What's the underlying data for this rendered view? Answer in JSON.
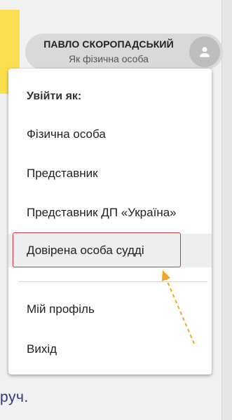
{
  "user": {
    "name": "ПАВЛО СКОРОПАДСЬКИЙ",
    "role": "Як фізична особа"
  },
  "menu": {
    "header": "Увійти як:",
    "items": [
      {
        "label": "Фізична особа"
      },
      {
        "label": "Представник"
      },
      {
        "label": "Представник ДП «Україна»"
      },
      {
        "label": "Довірена особа судді"
      }
    ],
    "bottom_items": [
      {
        "label": "Мій профіль"
      },
      {
        "label": "Вихід"
      }
    ]
  },
  "background": {
    "text": "руч."
  },
  "annotation": {
    "highlight_color": "#e0303a",
    "arrow_color": "#f5a623"
  },
  "colors": {
    "accent_yellow": "#fcdf4e"
  },
  "icons": {
    "avatar": "person-icon"
  }
}
